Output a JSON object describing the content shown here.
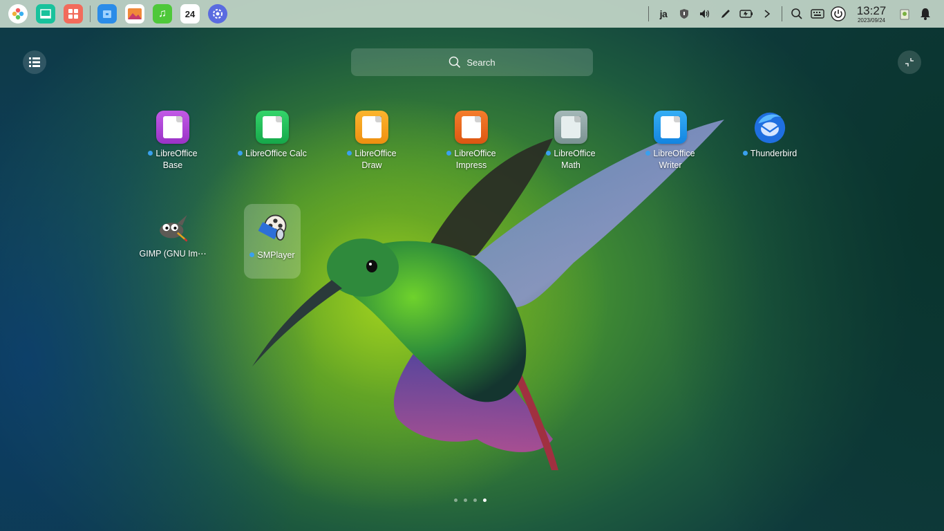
{
  "taskbar": {
    "dock": [
      {
        "name": "launcher-icon",
        "color": "#ffffff"
      },
      {
        "name": "terminal-icon",
        "color": "#18c29c"
      },
      {
        "name": "app-store-icon",
        "color": "#f26b5b"
      },
      {
        "name": "file-manager-icon",
        "color": "#2b8ce8"
      },
      {
        "name": "image-viewer-icon",
        "color": "#f08a3a"
      },
      {
        "name": "music-icon",
        "color": "#4ec83a"
      },
      {
        "name": "calendar-icon",
        "color": "#ffffff",
        "text": "24"
      },
      {
        "name": "settings-icon",
        "color": "#5a6be0"
      }
    ],
    "tray": {
      "input_method": "ja",
      "clock_time": "13:27",
      "clock_date": "2023/09/24"
    }
  },
  "search": {
    "placeholder": "Search"
  },
  "apps": [
    {
      "label": "LibreOffice Base",
      "color": "#b043d8",
      "running": true
    },
    {
      "label": "LibreOffice Calc",
      "color": "#20c258",
      "running": true
    },
    {
      "label": "LibreOffice Draw",
      "color": "#f5a21c",
      "running": true
    },
    {
      "label": "LibreOffice Impress",
      "color": "#ec6a1d",
      "running": true
    },
    {
      "label": "LibreOffice Math",
      "color": "#8fa6a6",
      "running": true
    },
    {
      "label": "LibreOffice Writer",
      "color": "#1d9af0",
      "running": true
    },
    {
      "label": "Thunderbird",
      "color": "#1a73e8",
      "running": true
    },
    {
      "label": "GIMP (GNU Im⋯",
      "color": "#5c5c5c",
      "running": false
    },
    {
      "label": "SMPlayer",
      "color": "#3a6fd8",
      "running": true,
      "selected": true
    }
  ],
  "pager": {
    "pages": 4,
    "current": 4
  }
}
